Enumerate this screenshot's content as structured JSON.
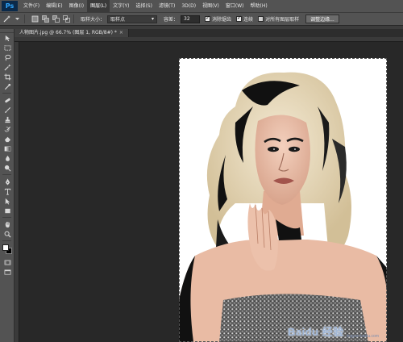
{
  "app": {
    "logo": "Ps"
  },
  "menu": [
    "文件(F)",
    "编辑(E)",
    "图像(I)",
    "图层(L)",
    "文字(Y)",
    "选择(S)",
    "滤镜(T)",
    "3D(D)",
    "视图(V)",
    "窗口(W)",
    "帮助(H)"
  ],
  "menu_active_index": 3,
  "options": {
    "sample_size_label": "取样大小：",
    "sample_size_value": "取样点",
    "tolerance_label": "容差：",
    "tolerance_value": "32",
    "antialias_label": "消除锯齿",
    "antialias_checked": true,
    "contiguous_label": "连续",
    "contiguous_checked": true,
    "all_layers_label": "对所有图层取样",
    "all_layers_checked": false,
    "refine_edge_label": "调整边缘..."
  },
  "document": {
    "tab_title": "人物图片.jpg @ 66.7% (图层 1, RGB/8#) *",
    "close_glyph": "×"
  },
  "tools": [
    "move-tool-icon",
    "marquee-tool-icon",
    "lasso-tool-icon",
    "magic-wand-tool-icon",
    "crop-tool-icon",
    "eyedropper-tool-icon",
    "healing-brush-tool-icon",
    "brush-tool-icon",
    "clone-stamp-tool-icon",
    "history-brush-tool-icon",
    "eraser-tool-icon",
    "gradient-tool-icon",
    "blur-tool-icon",
    "dodge-tool-icon",
    "pen-tool-icon",
    "type-tool-icon",
    "path-selection-tool-icon",
    "rectangle-tool-icon",
    "hand-tool-icon",
    "zoom-tool-icon"
  ],
  "colors": {
    "foreground": "#ffffff",
    "background": "#000000",
    "ui_dark": "#535353",
    "workspace": "#282828"
  },
  "watermark": {
    "brand": "Baidu 经验",
    "site": "jingyan.baidu.com"
  }
}
